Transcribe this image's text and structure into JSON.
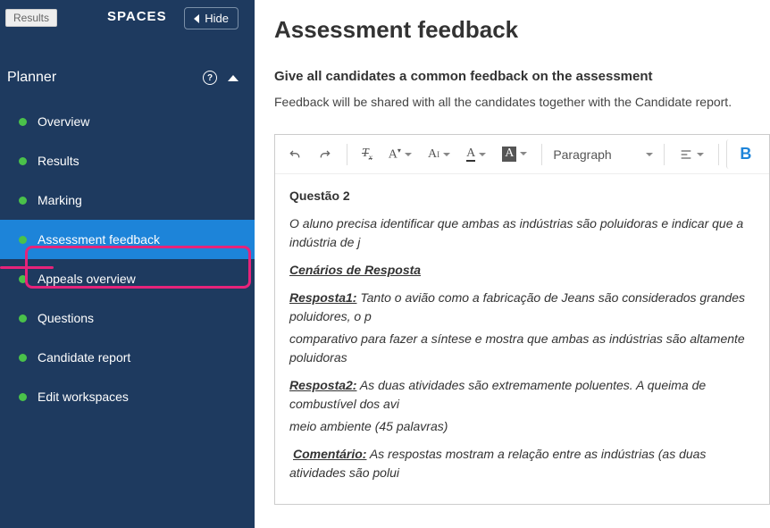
{
  "sidebar": {
    "badge": "Results",
    "spaces": "SPACES",
    "hide": "Hide",
    "section": "Planner",
    "items": [
      {
        "label": "Overview"
      },
      {
        "label": "Results"
      },
      {
        "label": "Marking"
      },
      {
        "label": "Assessment feedback"
      },
      {
        "label": "Appeals overview"
      },
      {
        "label": "Questions"
      },
      {
        "label": "Candidate report"
      },
      {
        "label": "Edit workspaces"
      }
    ]
  },
  "main": {
    "title": "Assessment feedback",
    "subtitle": "Give all candidates a common feedback on the assessment",
    "description": "Feedback will be shared with all the candidates together with the Candidate report."
  },
  "toolbar": {
    "paragraph": "Paragraph",
    "bold": "B"
  },
  "editor": {
    "q_title": "Questão 2",
    "intro": "O aluno precisa identificar que ambas as indústrias são poluidoras e indicar que a indústria de j",
    "cenarios": "Cenários de Resposta",
    "r1_label": "Resposta1:",
    "r1_text": " Tanto o avião como a fabricação de Jeans são considerados grandes poluidores, o p",
    "r1_line2": "comparativo para fazer a síntese e mostra que ambas as indústrias são altamente poluidoras",
    "r2_label": "Resposta2:",
    "r2_text": " As duas atividades são extremamente poluentes. A queima de combustível dos avi",
    "r2_line2": "meio ambiente (45 palavras)",
    "c_label": "Comentário:",
    "c_text": " As respostas mostram a relação entre as indústrias (as duas atividades são polui"
  }
}
